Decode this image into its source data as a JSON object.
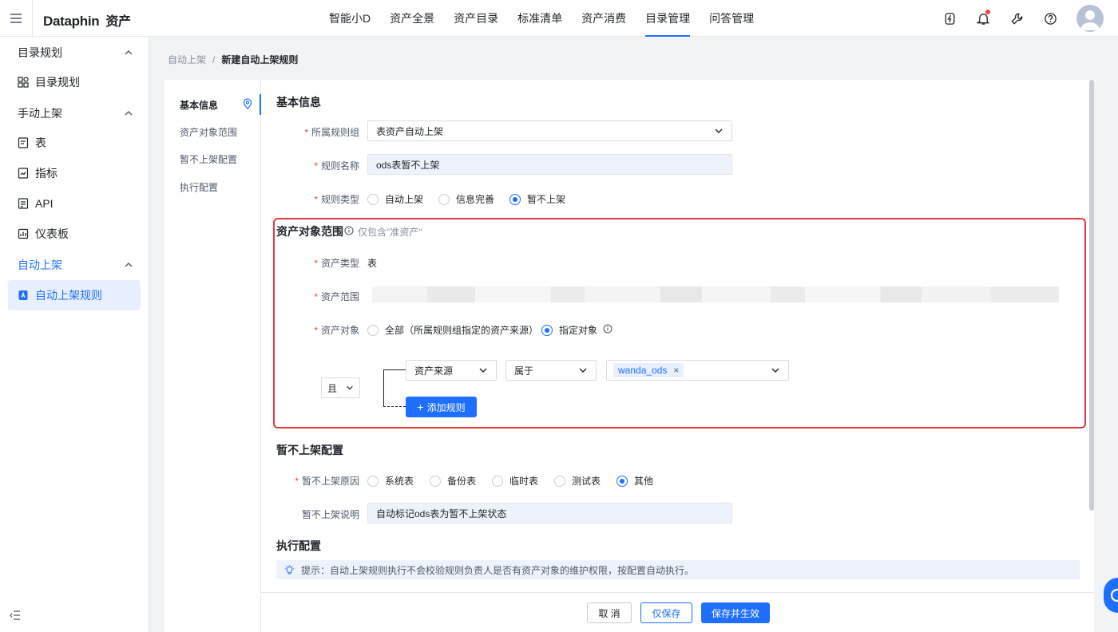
{
  "app": {
    "logo_text": "Dataphin",
    "logo_suffix": "资产"
  },
  "nav": {
    "items": [
      "智能小D",
      "资产全景",
      "资产目录",
      "标准清单",
      "资产消费",
      "目录管理",
      "问答管理"
    ],
    "active_index": 5
  },
  "top_icons": [
    "bolt-icon",
    "bell-icon",
    "wrench-icon",
    "help-icon",
    "avatar"
  ],
  "sidebar": {
    "groups": [
      {
        "label": "目录规划",
        "items": [
          {
            "label": "目录规划",
            "icon": "grid-icon"
          }
        ]
      },
      {
        "label": "手动上架",
        "items": [
          {
            "label": "表",
            "icon": "table-icon"
          },
          {
            "label": "指标",
            "icon": "metric-icon"
          },
          {
            "label": "API",
            "icon": "api-icon"
          },
          {
            "label": "仪表板",
            "icon": "dashboard-icon"
          }
        ]
      },
      {
        "label": "自动上架",
        "items": [
          {
            "label": "自动上架规则",
            "icon": "rule-icon"
          }
        ]
      }
    ]
  },
  "breadcrumb": {
    "parent": "自动上架",
    "separator": "/",
    "current": "新建自动上架规则"
  },
  "anchor": {
    "items": [
      "基本信息",
      "资产对象范围",
      "暂不上架配置",
      "执行配置"
    ],
    "active_index": 0
  },
  "basic": {
    "title": "基本信息",
    "rule_group_label": "所属规则组",
    "rule_group_value": "表资产自动上架",
    "rule_name_label": "规则名称",
    "rule_name_value": "ods表暂不上架",
    "rule_type_label": "规则类型",
    "rule_type_options": [
      "自动上架",
      "信息完善",
      "暂不上架"
    ],
    "rule_type_selected": 2
  },
  "scope": {
    "title": "资产对象范围",
    "hint": "仅包含\"准资产\"",
    "asset_type_label": "资产类型",
    "asset_type_value": "表",
    "asset_range_label": "资产范围",
    "asset_obj_label": "资产对象",
    "asset_obj_options": [
      "全部（所属规则组指定的资产来源）",
      "指定对象"
    ],
    "asset_obj_selected": 1,
    "logic_op": "且",
    "field_value": "资产来源",
    "operator_value": "属于",
    "tag_value": "wanda_ods",
    "add_rule_label": "添加规则"
  },
  "unlist": {
    "title": "暂不上架配置",
    "reason_label": "暂不上架原因",
    "reason_options": [
      "系统表",
      "备份表",
      "临时表",
      "测试表",
      "其他"
    ],
    "reason_selected": 4,
    "desc_label": "暂不上架说明",
    "desc_value": "自动标记ods表为暂不上架状态"
  },
  "exec": {
    "title": "执行配置",
    "tip": "提示：自动上架规则执行不会校验规则负责人是否有资产对象的维护权限，按配置自动执行。"
  },
  "footer": {
    "cancel": "取 消",
    "save_only": "仅保存",
    "save_apply": "保存并生效"
  },
  "colors": {
    "accent": "#1e6fff",
    "highlight_box": "#e5383b",
    "required": "#f53f3f"
  }
}
